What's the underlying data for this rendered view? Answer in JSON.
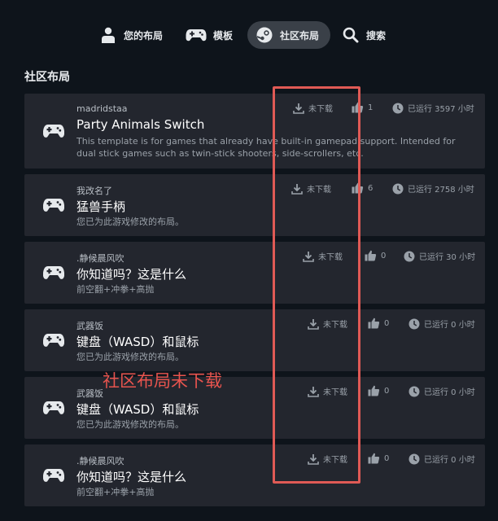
{
  "tabs": [
    {
      "label": "您的布局",
      "icon": "person-icon",
      "active": false
    },
    {
      "label": "模板",
      "icon": "gamepad-icon",
      "active": false
    },
    {
      "label": "社区布局",
      "icon": "steam-icon",
      "active": true
    },
    {
      "label": "搜索",
      "icon": "search-icon",
      "active": false
    }
  ],
  "section_title": "社区布局",
  "annotation": "社区布局未下载",
  "colors": {
    "background": "#0e141b",
    "card": "#23262e",
    "active_tab": "#3a4048",
    "annotation": "#e05a55"
  },
  "layouts": [
    {
      "author": "madridstaa",
      "name": "Party Animals Switch",
      "desc": "This template is for games that already have built-in gamepad support. Intended for dual stick games such as twin-stick shooters, side-scrollers, etc.",
      "download": "未下载",
      "likes": "1",
      "playtime": "已运行 3597 小时"
    },
    {
      "author": "我改名了",
      "name": "猛兽手柄",
      "desc": "您已为此游戏修改的布局。",
      "download": "未下载",
      "likes": "6",
      "playtime": "已运行 2758 小时"
    },
    {
      "author": ".静候晨风吹",
      "name": "你知道吗？这是什么",
      "desc": "前空翻+冲拳+高抛",
      "download": "未下载",
      "likes": "0",
      "playtime": "已运行 30 小时"
    },
    {
      "author": "武器饭",
      "name": "键盘（WASD）和鼠标",
      "desc": "您已为此游戏修改的布局。",
      "download": "未下载",
      "likes": "0",
      "playtime": "已运行 0 小时"
    },
    {
      "author": "武器饭",
      "name": "键盘（WASD）和鼠标",
      "desc": "您已为此游戏修改的布局。",
      "download": "未下载",
      "likes": "0",
      "playtime": "已运行 0 小时"
    },
    {
      "author": ".静候晨风吹",
      "name": "你知道吗？这是什么",
      "desc": "前空翻+冲拳+高抛",
      "download": "未下载",
      "likes": "0",
      "playtime": "已运行 0 小时"
    }
  ]
}
